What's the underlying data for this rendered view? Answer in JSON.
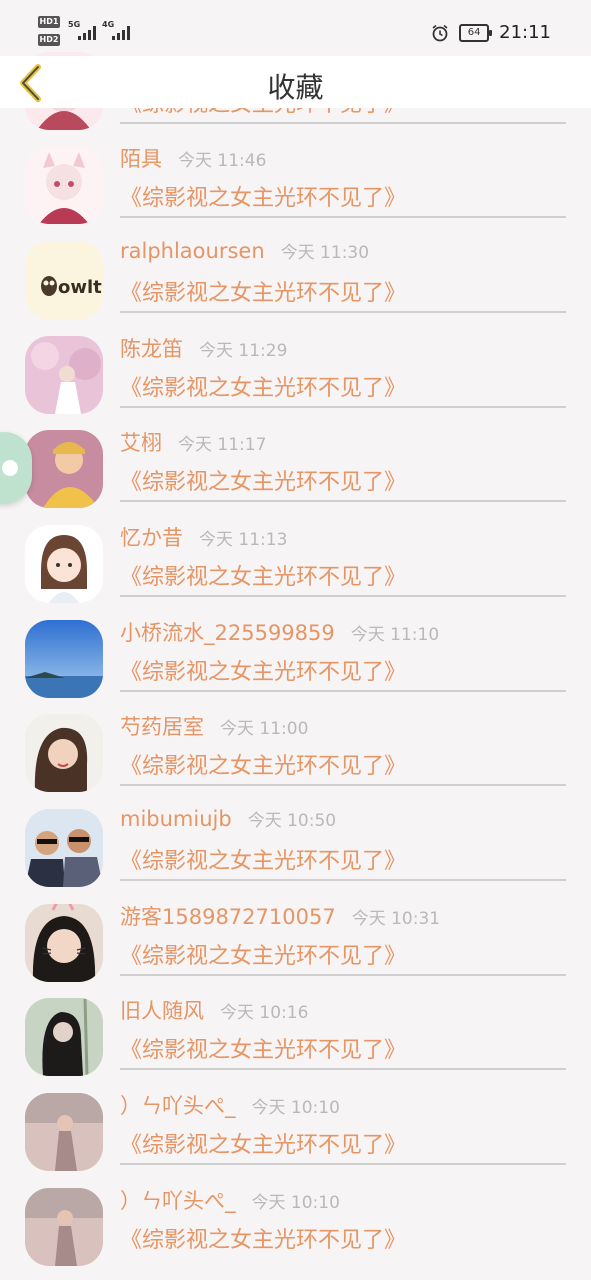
{
  "status_bar": {
    "hd1": "HD1",
    "hd2": "HD2",
    "net1": "5G",
    "net2": "4G",
    "battery": "64",
    "time": "21:11"
  },
  "header": {
    "title": "收藏",
    "back_icon": "chevron-left-icon"
  },
  "colors": {
    "accent": "#e69564",
    "back_icon": "#e3c23a",
    "meta": "#b9b9b9",
    "divider": "#cfcfcf"
  },
  "partial_row": {
    "book_title": "《综影视之女主光环不见了》"
  },
  "items": [
    {
      "name": "陌具",
      "time": "今天 11:46",
      "book": "《综影视之女主光环不见了》"
    },
    {
      "name": "ralphlaoursen",
      "time": "今天 11:30",
      "book": "《综影视之女主光环不见了》"
    },
    {
      "name": "陈龙笛",
      "time": "今天 11:29",
      "book": "《综影视之女主光环不见了》"
    },
    {
      "name": "艾栩",
      "time": "今天 11:17",
      "book": "《综影视之女主光环不见了》"
    },
    {
      "name": "忆か昔",
      "time": "今天 11:13",
      "book": "《综影视之女主光环不见了》"
    },
    {
      "name": "小桥流水_225599859",
      "time": "今天 11:10",
      "book": "《综影视之女主光环不见了》"
    },
    {
      "name": "芍药居室",
      "time": "今天 11:00",
      "book": "《综影视之女主光环不见了》"
    },
    {
      "name": "mibumiujb",
      "time": "今天 10:50",
      "book": "《综影视之女主光环不见了》"
    },
    {
      "name": "游客1589872710057",
      "time": "今天 10:31",
      "book": "《综影视之女主光环不见了》"
    },
    {
      "name": "旧人随风",
      "time": "今天 10:16",
      "book": "《综影视之女主光环不见了》"
    },
    {
      "name": "）ㄣ吖头ぺ_",
      "time": "今天 10:10",
      "book": "《综影视之女主光环不见了》"
    },
    {
      "name": "）ㄣ吖头ぺ_",
      "time": "今天 10:10",
      "book": "《综影视之女主光环不见了》"
    }
  ],
  "avatars": [
    {
      "logo": "owlt"
    }
  ]
}
